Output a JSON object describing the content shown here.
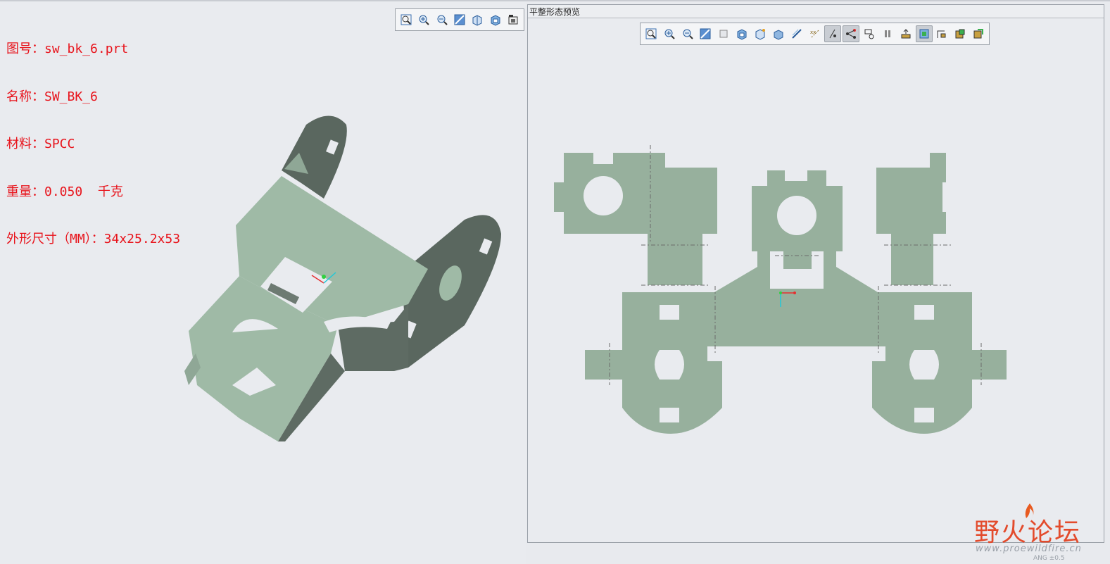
{
  "info": {
    "lines": [
      "图号：sw_bk_6.prt",
      "名称：SW_BK_6",
      "材料：SPCC",
      "重量：0.050  千克",
      "外形尺寸（MM）：34x25.2x53"
    ]
  },
  "preview": {
    "title": "平整形态预览"
  },
  "watermark": {
    "site_name": "野火论坛",
    "url": "www.proewildfire.cn",
    "dim_text": "ANG ±0.5"
  },
  "colors": {
    "info_text": "#e8141c",
    "part_light": "#9fbaa6",
    "part_dark": "#5c6a61",
    "flat_pattern": "#97b09d",
    "background": "#e9ebef"
  },
  "left_toolbar": [
    "zoom-fit-icon",
    "zoom-in-icon",
    "zoom-out-icon",
    "repaint-icon",
    "view-orientation-icon",
    "saved-views-icon",
    "display-style-icon"
  ],
  "right_toolbar": [
    "zoom-fit-icon",
    "zoom-in-icon",
    "zoom-out-icon",
    "repaint-icon",
    "view-orientation-icon",
    "saved-views-icon",
    "spin-center-icon",
    "named-view-icon",
    "plane-display-icon",
    "axis-display-icon",
    "point-display-icon",
    "csys-display-icon",
    "annotation-display-icon",
    "pause-icon",
    "shading-icon",
    "render-icon",
    "layer-icon",
    "settings-icon",
    "export-icon"
  ]
}
